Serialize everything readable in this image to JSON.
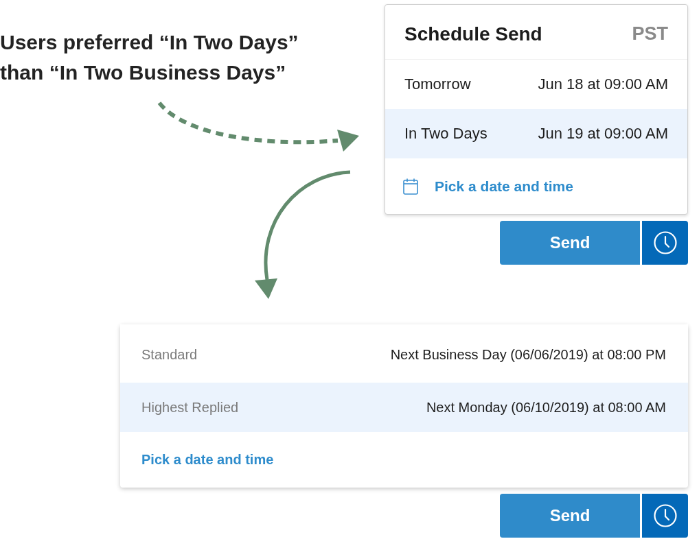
{
  "annotation": {
    "text": "Users preferred “In Two Days”\nthan “In Two Business Days”"
  },
  "schedule_popup": {
    "title": "Schedule Send",
    "timezone": "PST",
    "options": [
      {
        "label": "Tomorrow",
        "time": "Jun 18 at 09:00 AM",
        "selected": false
      },
      {
        "label": "In Two Days",
        "time": "Jun 19 at 09:00 AM",
        "selected": true
      }
    ],
    "pick_link": "Pick a date and time",
    "send_button": "Send"
  },
  "schedule_list": {
    "options": [
      {
        "label": "Standard",
        "time": "Next Business Day (06/06/2019) at 08:00 PM",
        "selected": false
      },
      {
        "label": "Highest Replied",
        "time": "Next Monday (06/10/2019) at 08:00 AM",
        "selected": true
      }
    ],
    "pick_link": "Pick a date and time",
    "send_button": "Send"
  }
}
